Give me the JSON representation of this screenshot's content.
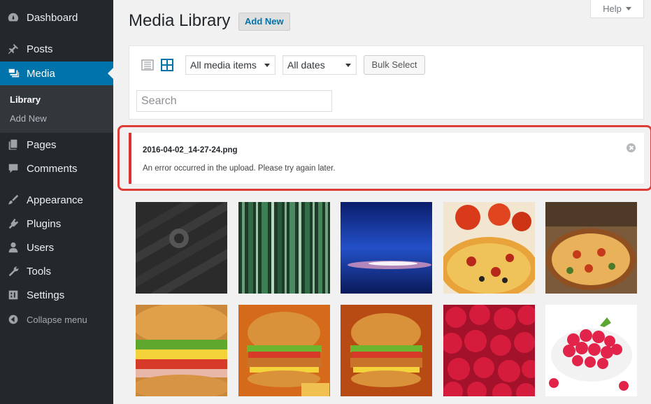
{
  "header": {
    "title": "Media Library",
    "add_new": "Add New",
    "help": "Help"
  },
  "sidebar": {
    "items": [
      {
        "label": "Dashboard",
        "icon": "dashboard-icon"
      },
      {
        "label": "Posts",
        "icon": "pin-icon"
      },
      {
        "label": "Media",
        "icon": "media-icon",
        "active": true
      },
      {
        "label": "Pages",
        "icon": "pages-icon"
      },
      {
        "label": "Comments",
        "icon": "comment-icon"
      },
      {
        "label": "Appearance",
        "icon": "paintbrush-icon"
      },
      {
        "label": "Plugins",
        "icon": "plugin-icon"
      },
      {
        "label": "Users",
        "icon": "user-icon"
      },
      {
        "label": "Tools",
        "icon": "wrench-icon"
      },
      {
        "label": "Settings",
        "icon": "settings-icon"
      }
    ],
    "submenu": [
      {
        "label": "Library",
        "current": true
      },
      {
        "label": "Add New"
      }
    ],
    "collapse": "Collapse menu"
  },
  "toolbar": {
    "media_filter": "All media items",
    "date_filter": "All dates",
    "bulk_select": "Bulk Select",
    "search_placeholder": "Search"
  },
  "notice": {
    "filename": "2016-04-02_14-27-24.png",
    "message": "An error occurred in the upload. Please try again later."
  },
  "colors": {
    "sidebar_bg": "#23282d",
    "accent": "#0073aa",
    "error": "#dc3232"
  },
  "thumbnails": [
    "dark-pattern-thumbnail",
    "green-stripes-thumbnail",
    "blue-light-thumbnail",
    "pizza-thumbnail",
    "pizza-table-thumbnail",
    "sandwich-thumbnail",
    "burger-thumbnail",
    "burger-thumbnail-2",
    "raspberries-thumbnail",
    "raspberry-bowl-thumbnail"
  ]
}
